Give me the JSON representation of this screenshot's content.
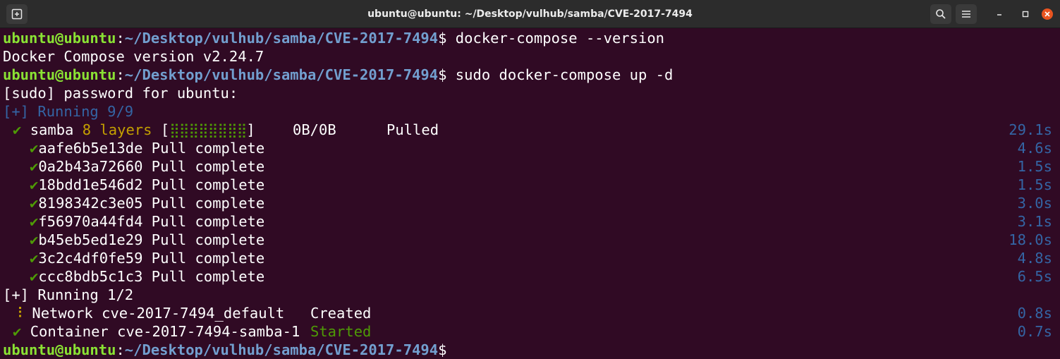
{
  "window": {
    "title": "ubuntu@ubuntu: ~/Desktop/vulhub/samba/CVE-2017-7494"
  },
  "prompt": {
    "user_host": "ubuntu@ubuntu",
    "colon": ":",
    "path": "~/Desktop/vulhub/samba/CVE-2017-7494",
    "dollar": "$"
  },
  "lines": {
    "cmd1": " docker-compose --version",
    "out1": "Docker Compose version v2.24.7",
    "cmd2": " sudo docker-compose up -d",
    "sudo_prompt": "[sudo] password for ubuntu:",
    "running1": "[+] Running 9/9",
    "check": "✔",
    "samba_name": "samba",
    "samba_layers": "8 layers",
    "bracket_open": "[",
    "progress_dots": "⣿⣿⣿⣿⣿⣿⣿⣿",
    "bracket_close": "]",
    "samba_size": "0B/0B",
    "samba_status": "Pulled",
    "samba_time": "29.1s",
    "running2": "[+] Running 1/2",
    "network_icon": "⠸",
    "network_text": "Network cve-2017-7494_default",
    "network_status": "Created",
    "network_time": "0.8s",
    "container_text": "Container cve-2017-7494-samba-1",
    "container_status": "Started",
    "container_time": "0.7s"
  },
  "layers": [
    {
      "id": "aafe6b5e13de",
      "status": "Pull complete",
      "time": "4.6s"
    },
    {
      "id": "0a2b43a72660",
      "status": "Pull complete",
      "time": "1.5s"
    },
    {
      "id": "18bdd1e546d2",
      "status": "Pull complete",
      "time": "1.5s"
    },
    {
      "id": "8198342c3e05",
      "status": "Pull complete",
      "time": "3.0s"
    },
    {
      "id": "f56970a44fd4",
      "status": "Pull complete",
      "time": "3.1s"
    },
    {
      "id": "b45eb5ed1e29",
      "status": "Pull complete",
      "time": "18.0s"
    },
    {
      "id": "3c2c4df0fe59",
      "status": "Pull complete",
      "time": "4.8s"
    },
    {
      "id": "ccc8bdb5c1c3",
      "status": "Pull complete",
      "time": "6.5s"
    }
  ],
  "icons": {
    "new_tab": "new-tab-icon",
    "search": "search-icon",
    "menu": "hamburger-menu-icon",
    "minimize": "minimize-icon",
    "maximize": "maximize-icon",
    "close": "close-icon"
  },
  "colors": {
    "background": "#300a24",
    "prompt_user": "#8ae234",
    "prompt_path": "#729fcf",
    "timing_blue": "#3465a4",
    "check_green": "#4e9a06",
    "layers_yellow": "#c4a000",
    "close_accent": "#e95420"
  }
}
